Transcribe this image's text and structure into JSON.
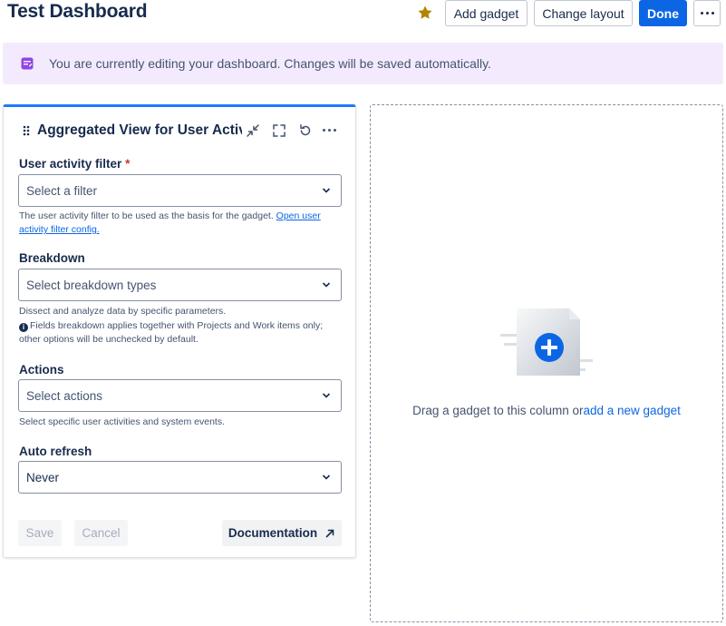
{
  "header": {
    "title": "Test Dashboard",
    "star_icon": "star-icon",
    "add_gadget_label": "Add gadget",
    "change_layout_label": "Change layout",
    "done_label": "Done",
    "more_icon": "more-icon"
  },
  "banner": {
    "icon": "edit-note-icon",
    "text": "You are currently editing your dashboard. Changes will be saved automatically."
  },
  "gadget": {
    "title": "Aggregated View for User Activi",
    "fields": {
      "filter": {
        "label": "User activity filter",
        "required_mark": "*",
        "placeholder": "Select a filter",
        "help": "The user activity filter to be used as the basis for the gadget.",
        "help_link": "Open user activity filter config."
      },
      "breakdown": {
        "label": "Breakdown",
        "placeholder": "Select breakdown types",
        "help": "Dissect and analyze data by specific parameters.",
        "info_glyph": "i",
        "info_note": "Fields breakdown applies together with Projects and Work items only; other options will be unchecked by default."
      },
      "actions": {
        "label": "Actions",
        "placeholder": "Select actions",
        "help": "Select specific user activities and system events."
      },
      "auto_refresh": {
        "label": "Auto refresh",
        "value": "Never"
      }
    },
    "footer": {
      "save_label": "Save",
      "cancel_label": "Cancel",
      "documentation_label": "Documentation"
    }
  },
  "dropzone": {
    "text": "Drag a gadget to this column or",
    "link": "add a new gadget"
  },
  "colors": {
    "primary": "#0c66e4",
    "banner_bg": "#f3ebfd",
    "star": "#b38600",
    "required": "#c9372c",
    "gadget_accent": "#1d7afc"
  }
}
